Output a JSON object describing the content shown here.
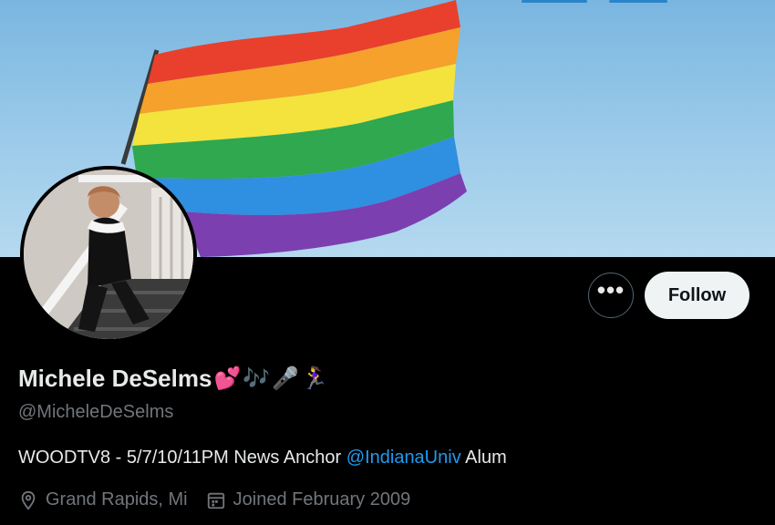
{
  "profile": {
    "name": "Michele DeSelms",
    "name_emojis": [
      "💕",
      "🎶",
      "🎤",
      "🏃‍♀️"
    ],
    "handle": "@MicheleDeSelms",
    "bio_prefix": "WOODTV8 - 5/7/10/11PM News Anchor ",
    "bio_mention": "@IndianaUniv",
    "bio_suffix": " Alum",
    "location": "Grand Rapids, Mi",
    "joined": "Joined February 2009"
  },
  "actions": {
    "more_label": "•••",
    "follow_label": "Follow"
  },
  "colors": {
    "background": "#000000",
    "follow_button_bg": "#eff3f4",
    "link": "#1d9bf0",
    "muted_text": "#71767b"
  },
  "icons": {
    "more": "more-horizontal-icon",
    "location": "location-pin-icon",
    "calendar": "calendar-icon"
  }
}
